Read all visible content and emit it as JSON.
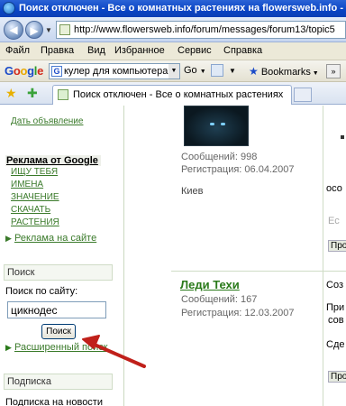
{
  "window": {
    "title": "Поиск отключен - Все о комнатных растениях на flowersweb.info - Windows Internet Explorer"
  },
  "address": {
    "url": "http://www.flowersweb.info/forum/messages/forum13/topic5"
  },
  "menu": [
    "Файл",
    "Правка",
    "Вид",
    "Избранное",
    "Сервис",
    "Справка"
  ],
  "google_toolbar": {
    "logo": "Google",
    "query": "кулер для компьютера",
    "go_label": "Go",
    "bookmarks_label": "Bookmarks"
  },
  "tab": {
    "title": "Поиск отключен - Все о комнатных растениях"
  },
  "sidebar": {
    "add_ad_link": "Дать объявление",
    "google_ads_title": "Реклама от Google",
    "ad_links": [
      "ИЩУ ТЕБЯ",
      "ИМЕНА",
      "ЗНАЧЕНИЕ",
      "СКАЧАТЬ",
      "РАСТЕНИЯ"
    ],
    "site_ads_link": "Реклама на сайте",
    "search_box_title": "Поиск",
    "search_label": "Поиск по сайту:",
    "search_value": "цикнодес",
    "search_button": "Поиск",
    "advanced_search_link": "Расширенный поиск",
    "subscription_box_title": "Подписка",
    "subscription_text": "Подписка на новости"
  },
  "posts": [
    {
      "messages": "Сообщений: 998",
      "registered": "Регистрация: 06.04.2007",
      "city": "Киев"
    },
    {
      "author": "Леди Техи",
      "messages": "Сообщений: 167",
      "registered": "Регистрация: 12.03.2007"
    }
  ],
  "right_fragments": [
    "осо",
    "Ес",
    "Про",
    "Соз",
    "При",
    "сов",
    "Сде",
    "Про"
  ],
  "colors": {
    "titlebar": "#0a44c4",
    "link_green": "#2a7a1a",
    "annotation_arrow": "#c0201a"
  }
}
